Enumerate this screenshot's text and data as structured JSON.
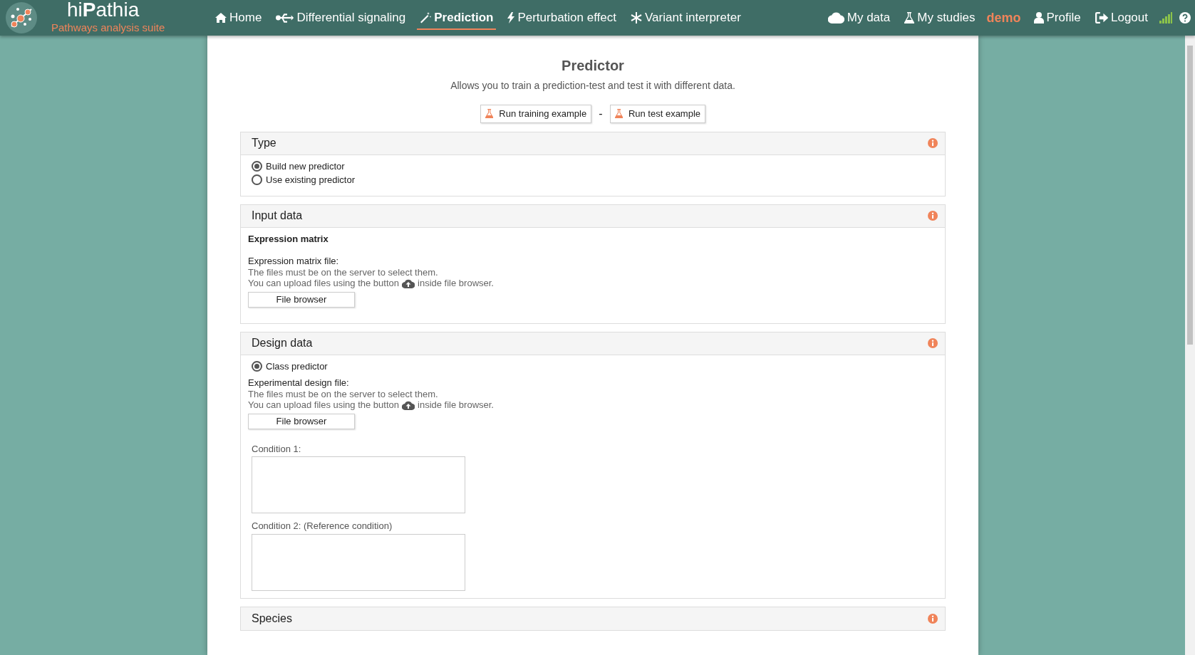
{
  "brand": {
    "name_before": "hi",
    "name_bold": "P",
    "name_after": "athia",
    "tagline": "Pathways analysis suite"
  },
  "nav": [
    {
      "label": "Home",
      "selected": false
    },
    {
      "label": "Differential signaling",
      "selected": false
    },
    {
      "label": "Prediction",
      "selected": true
    },
    {
      "label": "Perturbation effect",
      "selected": false
    },
    {
      "label": "Variant interpreter",
      "selected": false
    }
  ],
  "nav_right": [
    {
      "kind": "link",
      "label": "My data"
    },
    {
      "kind": "link",
      "label": "My studies"
    },
    {
      "kind": "user",
      "label": "demo"
    },
    {
      "kind": "link",
      "label": "Profile"
    },
    {
      "kind": "link",
      "label": "Logout"
    },
    {
      "kind": "signal"
    },
    {
      "kind": "help"
    }
  ],
  "page": {
    "title": "Predictor",
    "subtitle": "Allows you to train a prediction-test and test it with different data.",
    "examples": [
      "Run training example",
      "Run test example"
    ],
    "separator": "-"
  },
  "sections": [
    {
      "title": "Type",
      "blocks": [
        {
          "kind": "radios",
          "options": [
            {
              "label": "Build new predictor",
              "selected": true
            },
            {
              "label": "Use existing predictor",
              "selected": false
            }
          ]
        }
      ]
    },
    {
      "title": "Input data",
      "blocks": [
        {
          "kind": "subheading",
          "text": "Expression matrix"
        },
        {
          "kind": "file",
          "label": "Expression matrix file:",
          "hint": "The files must be on the server to select them.",
          "upload_before": "You can upload files using the button",
          "upload_after": "inside file browser.",
          "button": "File browser"
        }
      ]
    },
    {
      "title": "Design data",
      "blocks": [
        {
          "kind": "radios",
          "options": [
            {
              "label": "Class predictor",
              "selected": true
            }
          ]
        },
        {
          "kind": "file",
          "label": "Experimental design file:",
          "hint": "The files must be on the server to select them.",
          "upload_before": "You can upload files using the button",
          "upload_after": "inside file browser.",
          "button": "File browser"
        },
        {
          "kind": "textareas",
          "fields": [
            {
              "label": "Condition 1:"
            },
            {
              "label": "Condition 2: (Reference condition)"
            }
          ]
        }
      ]
    },
    {
      "title": "Species"
    }
  ]
}
